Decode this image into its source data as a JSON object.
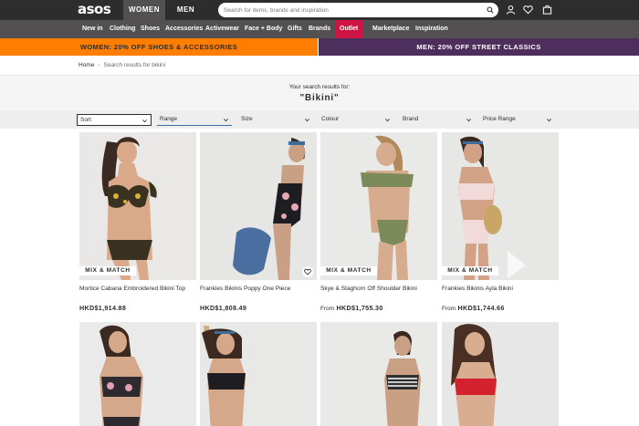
{
  "header": {
    "logo": "asos",
    "gender_tabs": [
      "WOMEN",
      "MEN"
    ],
    "search_placeholder": "Search for items, brands and inspiration",
    "icons": [
      "search-icon",
      "account-icon",
      "saved-items-icon",
      "bag-icon"
    ]
  },
  "nav": {
    "items": [
      "New in",
      "Clothing",
      "Shoes",
      "Accessories",
      "Activewear",
      "Face + Body",
      "Gifts",
      "Brands",
      "Outlet",
      "Marketplace",
      "Inspiration"
    ]
  },
  "promos": {
    "women": "WOMEN: 20% OFF SHOES & ACCESSORIES",
    "men": "MEN: 20% OFF STREET CLASSICS"
  },
  "breadcrumb": {
    "home": "Home",
    "separator": "›",
    "current": "Search results for bikini"
  },
  "results": {
    "subtitle": "Your search results for:",
    "term": "\"Bikini\""
  },
  "filters": [
    "Sort",
    "Range",
    "Size",
    "Colour",
    "Brand",
    "Price Range"
  ],
  "products": [
    {
      "name": "Mortice Cabana Embroidered Bikini Top",
      "price_prefix": "",
      "price": "HKD$1,914.88",
      "badge": "MIX & MATCH",
      "has_heart": false
    },
    {
      "name": "Frankies Bikinis Poppy One Piece",
      "price_prefix": "",
      "price": "HKD$1,808.49",
      "badge": "",
      "has_heart": true
    },
    {
      "name": "Skye & Staghorn Off Shoulder Bikini",
      "price_prefix": "From",
      "price": "HKD$1,755.30",
      "badge": "MIX & MATCH",
      "has_heart": false
    },
    {
      "name": "Frankies Bikinis Ayla Bikini",
      "price_prefix": "From",
      "price": "HKD$1,744.66",
      "badge": "MIX & MATCH",
      "has_heart": false
    }
  ],
  "colors": {
    "topbar": "#2d2d2d",
    "navbar": "#525050",
    "outlet": "#d01345",
    "promo_women": "#ff7e00",
    "promo_men": "#4e2e5d"
  }
}
